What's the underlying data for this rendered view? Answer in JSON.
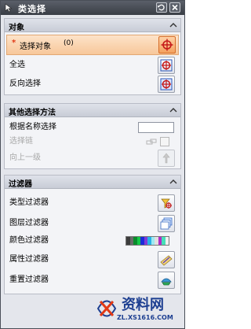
{
  "window": {
    "title": "类选择"
  },
  "objects_section": {
    "header": "对象",
    "select_objects": {
      "prefix": "*",
      "label": "选择对象",
      "count": "(0)"
    },
    "select_all": "全选",
    "invert_selection": "反向选择"
  },
  "other_methods_section": {
    "header": "其他选择方法",
    "select_by_name": "根据名称选择",
    "select_chain": "选择链",
    "up_one_level": "向上一级"
  },
  "filters_section": {
    "header": "过滤器",
    "type_filter": "类型过滤器",
    "layer_filter": "图层过滤器",
    "color_filter": "颜色过滤器",
    "attribute_filter": "属性过滤器",
    "reset_filter": "重置过滤器"
  },
  "color_swatches": [
    "#3c3c3c",
    "#6a6a6a",
    "#0a8c2c",
    "#15c84a",
    "#1a2bd9",
    "#7f3ad8",
    "#26b4e8",
    "#9ee8f2",
    "#e0e0e0",
    "#b02cc8",
    "#46e0b8",
    "#f0f0f0"
  ],
  "watermark": {
    "title": "资料网",
    "url": "ZL.XS1616.COM"
  }
}
